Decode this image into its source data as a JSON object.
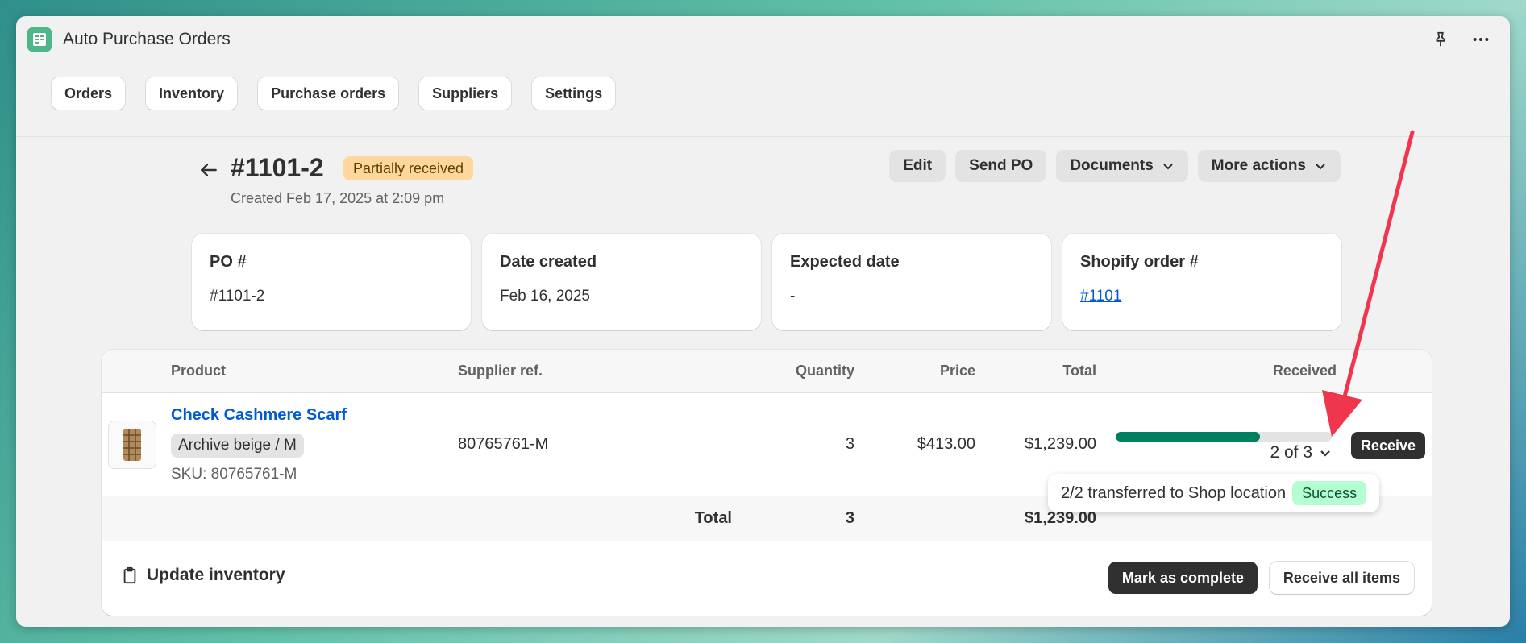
{
  "app": {
    "title": "Auto Purchase Orders",
    "icon": "spreadsheet-icon"
  },
  "nav": {
    "tabs": [
      {
        "label": "Orders"
      },
      {
        "label": "Inventory"
      },
      {
        "label": "Purchase orders"
      },
      {
        "label": "Suppliers"
      },
      {
        "label": "Settings"
      }
    ]
  },
  "header": {
    "title": "#1101-2",
    "status": "Partially received",
    "created": "Created Feb 17, 2025 at 2:09 pm",
    "actions": {
      "edit": "Edit",
      "send": "Send PO",
      "documents": "Documents",
      "more": "More actions"
    }
  },
  "cards": [
    {
      "label": "PO #",
      "value": "#1101-2"
    },
    {
      "label": "Date created",
      "value": "Feb 16, 2025"
    },
    {
      "label": "Expected date",
      "value": "-"
    },
    {
      "label": "Shopify order #",
      "value": "#1101"
    }
  ],
  "table": {
    "columns": {
      "product": "Product",
      "supplier_ref": "Supplier ref.",
      "quantity": "Quantity",
      "price": "Price",
      "total": "Total",
      "received": "Received"
    },
    "row": {
      "product": "Check Cashmere Scarf",
      "variant": "Archive beige / M",
      "sku": "SKU: 80765761-M",
      "supplier_ref": "80765761-M",
      "quantity": "3",
      "price": "$413.00",
      "total": "$1,239.00",
      "received_text": "2 of 3",
      "received_fraction": 0.667,
      "receive_label": "Receive"
    },
    "totals": {
      "label": "Total",
      "quantity": "3",
      "total": "$1,239.00"
    }
  },
  "tooltip": {
    "text": "2/2 transferred to Shop location",
    "status": "Success"
  },
  "footer": {
    "update_inventory": "Update inventory",
    "mark_complete": "Mark as complete",
    "receive_all": "Receive all items"
  },
  "colors": {
    "accent_green": "#007f5f",
    "link": "#005bd3",
    "annotation_arrow": "#f0364f"
  }
}
